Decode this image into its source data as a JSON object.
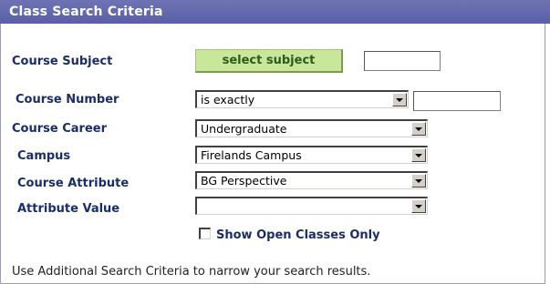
{
  "header": {
    "title": "Class Search Criteria"
  },
  "fields": {
    "course_subject": {
      "label": "Course Subject",
      "button_label": "select subject",
      "value": ""
    },
    "course_number": {
      "label": "Course Number",
      "operator": "is exactly",
      "value": ""
    },
    "course_career": {
      "label": "Course Career",
      "value": "Undergraduate"
    },
    "campus": {
      "label": "Campus",
      "value": "Firelands Campus"
    },
    "course_attribute": {
      "label": "Course Attribute",
      "value": "BG Perspective"
    },
    "attribute_value": {
      "label": "Attribute Value",
      "value": ""
    }
  },
  "open_classes": {
    "label": "Show Open Classes Only",
    "checked": false
  },
  "hint": "Use Additional Search Criteria to narrow your search results.",
  "colors": {
    "header_bg": "#6f73b5",
    "label_text": "#1a2d6b",
    "button_bg": "#c9e79b",
    "button_text": "#2d5a1a"
  }
}
